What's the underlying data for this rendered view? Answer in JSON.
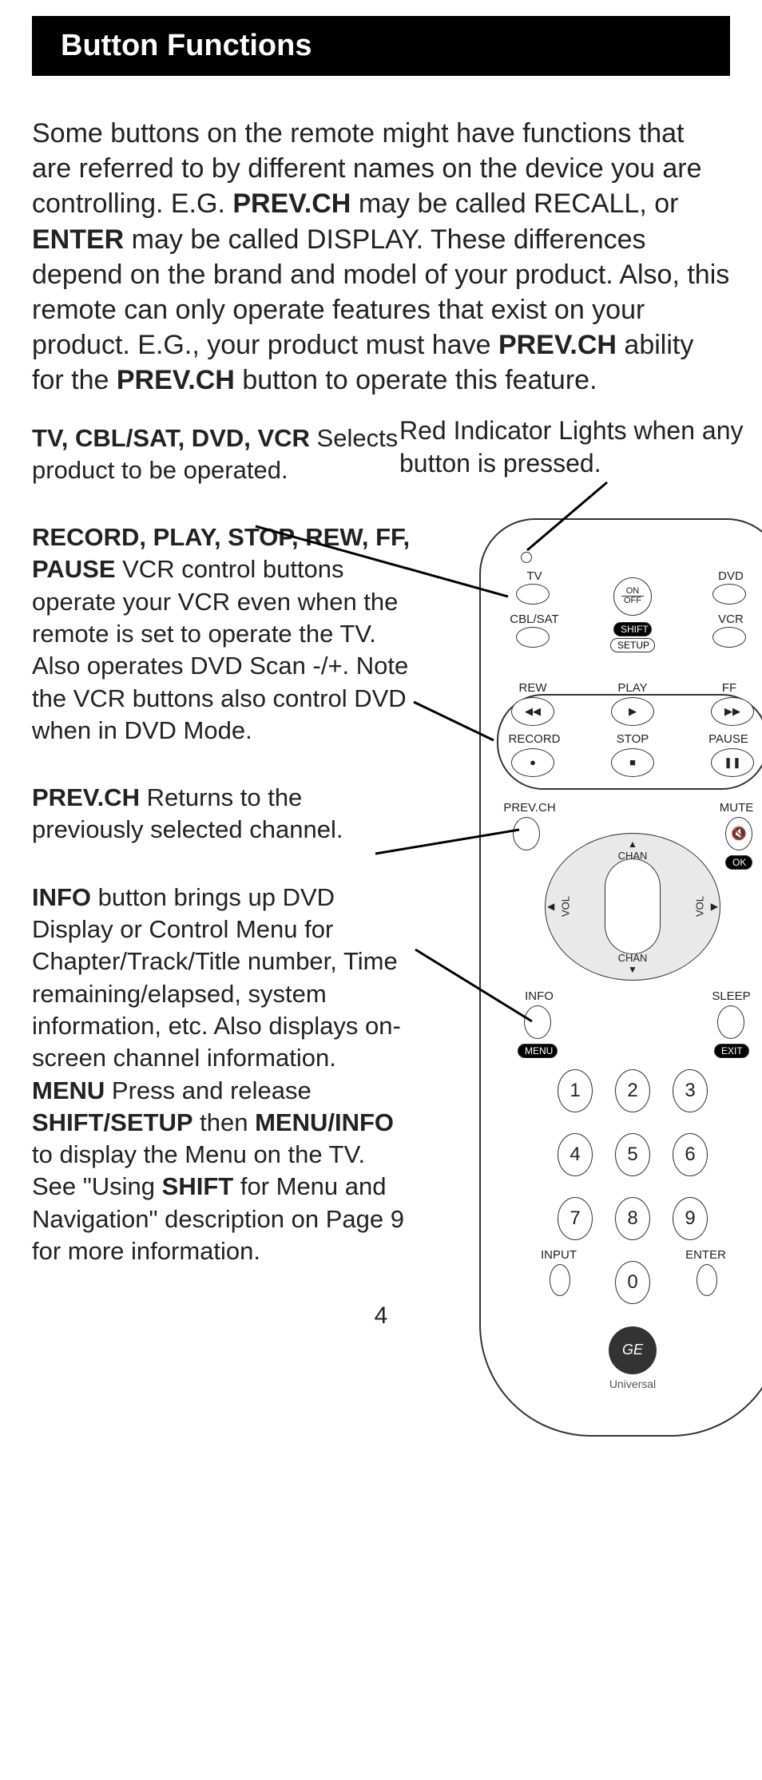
{
  "title": "Button Functions",
  "intro_segments": [
    {
      "t": "Some buttons on the remote might have functions that are referred to by different names on the device you are controlling. E.G. ",
      "b": false
    },
    {
      "t": "PREV.CH",
      "b": true
    },
    {
      "t": " may be called RECALL, or ",
      "b": false
    },
    {
      "t": "ENTER",
      "b": true
    },
    {
      "t": " may be called DISPLAY. These differences depend on the brand and model of your product. Also, this remote can only operate features that exist on your product. E.G., your product must have ",
      "b": false
    },
    {
      "t": "PREV.CH",
      "b": true
    },
    {
      "t": " ability for the ",
      "b": false
    },
    {
      "t": "PREV.CH",
      "b": true
    },
    {
      "t": " button to operate this feature.",
      "b": false
    }
  ],
  "red_indicator": "Red Indicator Lights when any button is pressed.",
  "callouts": {
    "device_select": {
      "head": "TV, CBL/SAT, DVD, VCR",
      "body": " Selects product to be operated."
    },
    "transport": {
      "head": "RECORD, PLAY, STOP, REW, FF, PAUSE",
      "body": " VCR control buttons operate your VCR even when the remote is set to operate the TV. Also operates DVD Scan -/+. Note the VCR buttons also control DVD when in DVD Mode."
    },
    "prevch": {
      "head": "PREV.CH",
      "body": "  Returns to the previously selected channel."
    },
    "info_menu_segments": [
      {
        "t": "INFO",
        "b": true
      },
      {
        "t": " button brings up DVD Display or Control Menu for Chapter/Track/Title number, Time remaining/elapsed, system information, etc. Also displays on-screen channel information.\n",
        "b": false
      },
      {
        "t": "MENU",
        "b": true
      },
      {
        "t": " Press and release ",
        "b": false
      },
      {
        "t": "SHIFT/SETUP",
        "b": true
      },
      {
        "t": " then ",
        "b": false
      },
      {
        "t": "MENU/INFO",
        "b": true
      },
      {
        "t": " to display the Menu on the TV. See \"Using ",
        "b": false
      },
      {
        "t": "SHIFT",
        "b": true
      },
      {
        "t": " for Menu and Navigation\" description on Page 9 for more information.",
        "b": false
      }
    ]
  },
  "remote": {
    "labels": {
      "tv": "TV",
      "dvd": "DVD",
      "cblsat": "CBL/SAT",
      "vcr": "VCR",
      "on": "ON",
      "off": "OFF",
      "shift": "SHIFT",
      "setup": "SETUP",
      "rew": "REW",
      "play": "PLAY",
      "ff": "FF",
      "record": "RECORD",
      "stop": "STOP",
      "pause": "PAUSE",
      "prevch": "PREV.CH",
      "mute": "MUTE",
      "ok": "OK",
      "chan": "CHAN",
      "vol": "VOL",
      "info": "INFO",
      "sleep": "SLEEP",
      "menu": "MENU",
      "exit": "EXIT",
      "input": "INPUT",
      "enter": "ENTER",
      "universal": "Universal"
    },
    "numbers": [
      "1",
      "2",
      "3",
      "4",
      "5",
      "6",
      "7",
      "8",
      "9",
      "0"
    ]
  },
  "page_number": "4"
}
